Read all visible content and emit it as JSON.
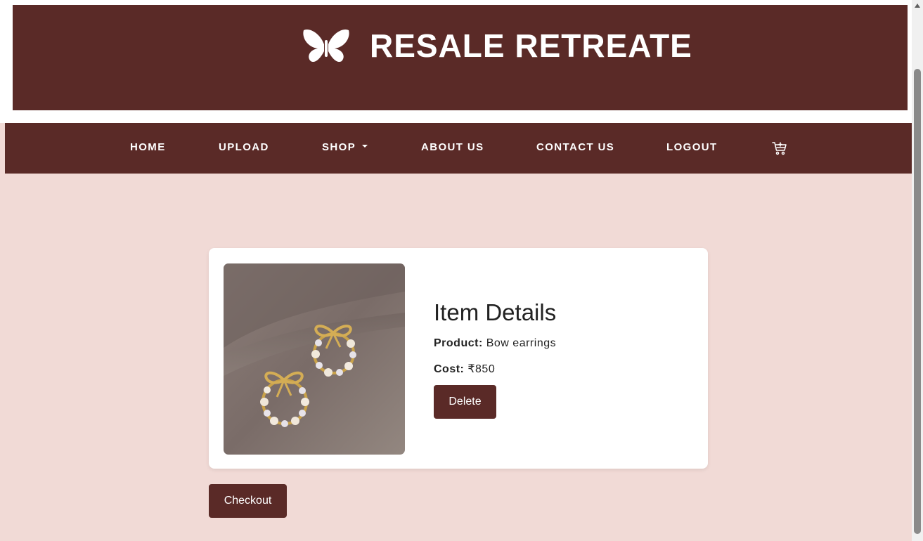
{
  "brand": {
    "name": "RESALE RETREATE",
    "logo_icon": "butterfly-icon",
    "banner_color": "#5a2a27"
  },
  "nav": {
    "items": [
      {
        "label": "HOME"
      },
      {
        "label": "UPLOAD"
      },
      {
        "label": "SHOP",
        "has_dropdown": true
      },
      {
        "label": "ABOUT US"
      },
      {
        "label": "CONTACT US"
      },
      {
        "label": "LOGOUT"
      }
    ],
    "cart_icon": "cart-icon"
  },
  "cart": {
    "item": {
      "title": "Item Details",
      "product_label": "Product:",
      "product_value": "Bow earrings",
      "cost_label": "Cost:",
      "cost_value": "₹850",
      "delete_label": "Delete",
      "image_icon": "bow-earrings-image"
    },
    "checkout_label": "Checkout"
  },
  "colors": {
    "accent": "#5a2a27",
    "page_background": "#f1dad6",
    "card_background": "#ffffff"
  }
}
